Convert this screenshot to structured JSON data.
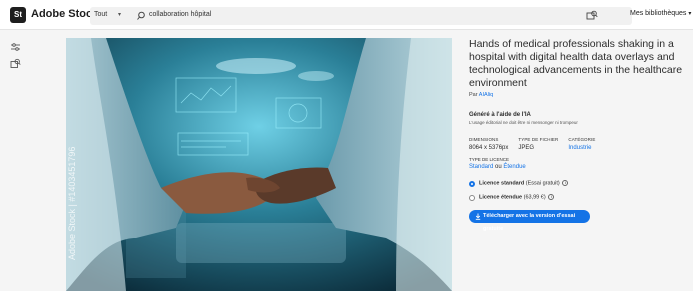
{
  "header": {
    "logo_text": "St",
    "brand": "Adobe Stock",
    "scope": "Tout",
    "search_value": "collaboration hôpital",
    "libraries": "Mes bibliothèques"
  },
  "image": {
    "watermark": "Adobe Stock | #1403451796"
  },
  "details": {
    "title": "Hands of medical professionals shaking in a hospital with digital health data overlays and technological advancements in the healthcare environment",
    "by_prefix": "Par",
    "author": "AIAliq",
    "ai_badge": "Généré à l'aide de l'IA",
    "ai_note": "L'usage éditorial ne doit être ni mensonger ni trompeur",
    "dimensions_label": "DIMENSIONS",
    "dimensions_value": "8064 x 5376px",
    "filetype_label": "TYPE DE FICHIER",
    "filetype_value": "JPEG",
    "category_label": "CATÉGORIE",
    "category_value": "Industrie",
    "license_type_label": "TYPE DE LICENCE",
    "license_standard": "Standard",
    "license_or": "ou",
    "license_extended": "Étendue",
    "radio_standard_bold": "Licence standard",
    "radio_standard_rest": "(Essai gratuit)",
    "radio_extended_bold": "Licence étendue",
    "radio_extended_rest": "(63,99 €)",
    "info_glyph": "i",
    "download_label": "Télécharger avec la version d'essai gratuite"
  },
  "colors": {
    "accent": "#1473e6",
    "image_bg": "#0f3a4a"
  }
}
